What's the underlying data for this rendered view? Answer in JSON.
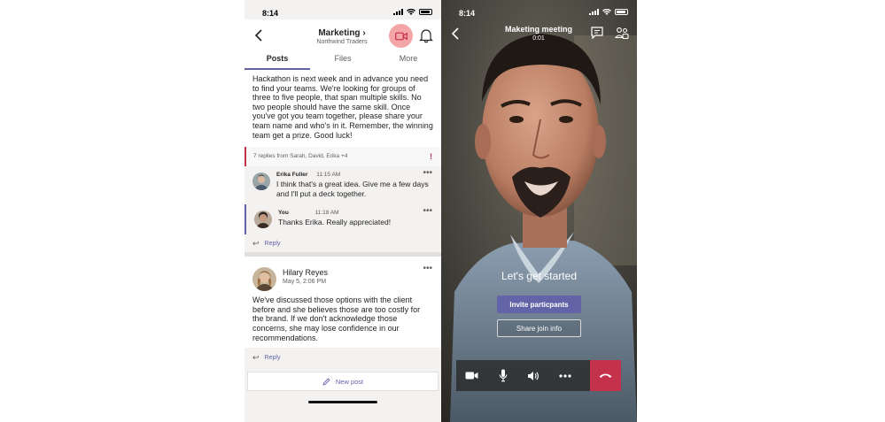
{
  "channel_screen": {
    "status_time": "8:14",
    "channel_name": "Marketing",
    "channel_chevron": "›",
    "team_name": "Northwind Traders",
    "tabs": [
      {
        "label": "Posts",
        "active": true
      },
      {
        "label": "Files",
        "active": false
      },
      {
        "label": "More",
        "active": false
      }
    ],
    "post1_text": "Hackathon is next week and in advance you need to find your teams. We're looking for groups of three to five people, that span multiple skills. No two people should have the same skill. Once you've got you team together, please share your team name and who's in it. Remember, the winning team get a prize. Good luck!",
    "replies_summary": "7 replies from Sarah, David, Erika +4",
    "important_mark": "!",
    "replies": [
      {
        "author": "Erika Fuller",
        "time": "11:15 AM",
        "text": "I think that's a great idea. Give me a few days and I'll put a deck together.",
        "more": "•••"
      },
      {
        "author": "You",
        "time": "11:18 AM",
        "text": "Thanks Erika. Really appreciated!",
        "more": "•••"
      }
    ],
    "reply_label": "Reply",
    "post2": {
      "author": "Hilary Reyes",
      "date": "May 5, 2:06 PM",
      "more": "•••",
      "text": "We've discussed those options with the client before and she believes those are too costly for the brand. If we don't acknowledge those concerns, she may lose confidence in our recommendations."
    },
    "reply_label_2": "Reply",
    "new_post_label": "New post",
    "colors": {
      "accent": "#6264a7",
      "important": "#c4314b",
      "video_button_bg": "#f4a6a6"
    }
  },
  "call_screen": {
    "status_time": "8:14",
    "meeting_title": "Maketing meeting",
    "timer": "0:01",
    "start_label": "Let's get started",
    "invite_label": "Invite particpants",
    "share_label": "Share join info",
    "controls": [
      "camera-icon",
      "microphone-icon",
      "speaker-icon",
      "more-icon",
      "hangup-icon"
    ],
    "colors": {
      "hangup": "#c4314b",
      "invite": "#6264a7"
    }
  }
}
